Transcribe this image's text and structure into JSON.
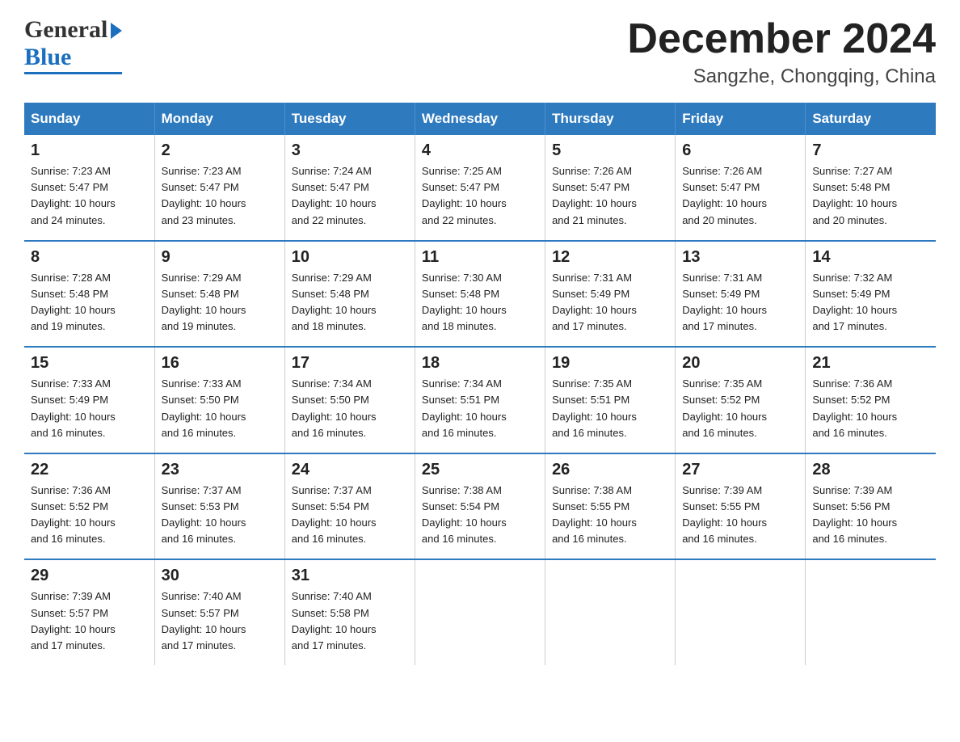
{
  "header": {
    "title": "December 2024",
    "subtitle": "Sangzhe, Chongqing, China",
    "logo_general": "General",
    "logo_blue": "Blue"
  },
  "columns": [
    "Sunday",
    "Monday",
    "Tuesday",
    "Wednesday",
    "Thursday",
    "Friday",
    "Saturday"
  ],
  "weeks": [
    [
      {
        "day": "1",
        "sunrise": "7:23 AM",
        "sunset": "5:47 PM",
        "daylight": "10 hours and 24 minutes."
      },
      {
        "day": "2",
        "sunrise": "7:23 AM",
        "sunset": "5:47 PM",
        "daylight": "10 hours and 23 minutes."
      },
      {
        "day": "3",
        "sunrise": "7:24 AM",
        "sunset": "5:47 PM",
        "daylight": "10 hours and 22 minutes."
      },
      {
        "day": "4",
        "sunrise": "7:25 AM",
        "sunset": "5:47 PM",
        "daylight": "10 hours and 22 minutes."
      },
      {
        "day": "5",
        "sunrise": "7:26 AM",
        "sunset": "5:47 PM",
        "daylight": "10 hours and 21 minutes."
      },
      {
        "day": "6",
        "sunrise": "7:26 AM",
        "sunset": "5:47 PM",
        "daylight": "10 hours and 20 minutes."
      },
      {
        "day": "7",
        "sunrise": "7:27 AM",
        "sunset": "5:48 PM",
        "daylight": "10 hours and 20 minutes."
      }
    ],
    [
      {
        "day": "8",
        "sunrise": "7:28 AM",
        "sunset": "5:48 PM",
        "daylight": "10 hours and 19 minutes."
      },
      {
        "day": "9",
        "sunrise": "7:29 AM",
        "sunset": "5:48 PM",
        "daylight": "10 hours and 19 minutes."
      },
      {
        "day": "10",
        "sunrise": "7:29 AM",
        "sunset": "5:48 PM",
        "daylight": "10 hours and 18 minutes."
      },
      {
        "day": "11",
        "sunrise": "7:30 AM",
        "sunset": "5:48 PM",
        "daylight": "10 hours and 18 minutes."
      },
      {
        "day": "12",
        "sunrise": "7:31 AM",
        "sunset": "5:49 PM",
        "daylight": "10 hours and 17 minutes."
      },
      {
        "day": "13",
        "sunrise": "7:31 AM",
        "sunset": "5:49 PM",
        "daylight": "10 hours and 17 minutes."
      },
      {
        "day": "14",
        "sunrise": "7:32 AM",
        "sunset": "5:49 PM",
        "daylight": "10 hours and 17 minutes."
      }
    ],
    [
      {
        "day": "15",
        "sunrise": "7:33 AM",
        "sunset": "5:49 PM",
        "daylight": "10 hours and 16 minutes."
      },
      {
        "day": "16",
        "sunrise": "7:33 AM",
        "sunset": "5:50 PM",
        "daylight": "10 hours and 16 minutes."
      },
      {
        "day": "17",
        "sunrise": "7:34 AM",
        "sunset": "5:50 PM",
        "daylight": "10 hours and 16 minutes."
      },
      {
        "day": "18",
        "sunrise": "7:34 AM",
        "sunset": "5:51 PM",
        "daylight": "10 hours and 16 minutes."
      },
      {
        "day": "19",
        "sunrise": "7:35 AM",
        "sunset": "5:51 PM",
        "daylight": "10 hours and 16 minutes."
      },
      {
        "day": "20",
        "sunrise": "7:35 AM",
        "sunset": "5:52 PM",
        "daylight": "10 hours and 16 minutes."
      },
      {
        "day": "21",
        "sunrise": "7:36 AM",
        "sunset": "5:52 PM",
        "daylight": "10 hours and 16 minutes."
      }
    ],
    [
      {
        "day": "22",
        "sunrise": "7:36 AM",
        "sunset": "5:52 PM",
        "daylight": "10 hours and 16 minutes."
      },
      {
        "day": "23",
        "sunrise": "7:37 AM",
        "sunset": "5:53 PM",
        "daylight": "10 hours and 16 minutes."
      },
      {
        "day": "24",
        "sunrise": "7:37 AM",
        "sunset": "5:54 PM",
        "daylight": "10 hours and 16 minutes."
      },
      {
        "day": "25",
        "sunrise": "7:38 AM",
        "sunset": "5:54 PM",
        "daylight": "10 hours and 16 minutes."
      },
      {
        "day": "26",
        "sunrise": "7:38 AM",
        "sunset": "5:55 PM",
        "daylight": "10 hours and 16 minutes."
      },
      {
        "day": "27",
        "sunrise": "7:39 AM",
        "sunset": "5:55 PM",
        "daylight": "10 hours and 16 minutes."
      },
      {
        "day": "28",
        "sunrise": "7:39 AM",
        "sunset": "5:56 PM",
        "daylight": "10 hours and 16 minutes."
      }
    ],
    [
      {
        "day": "29",
        "sunrise": "7:39 AM",
        "sunset": "5:57 PM",
        "daylight": "10 hours and 17 minutes."
      },
      {
        "day": "30",
        "sunrise": "7:40 AM",
        "sunset": "5:57 PM",
        "daylight": "10 hours and 17 minutes."
      },
      {
        "day": "31",
        "sunrise": "7:40 AM",
        "sunset": "5:58 PM",
        "daylight": "10 hours and 17 minutes."
      },
      {
        "day": "",
        "sunrise": "",
        "sunset": "",
        "daylight": ""
      },
      {
        "day": "",
        "sunrise": "",
        "sunset": "",
        "daylight": ""
      },
      {
        "day": "",
        "sunrise": "",
        "sunset": "",
        "daylight": ""
      },
      {
        "day": "",
        "sunrise": "",
        "sunset": "",
        "daylight": ""
      }
    ]
  ],
  "labels": {
    "sunrise_prefix": "Sunrise: ",
    "sunset_prefix": "Sunset: ",
    "daylight_prefix": "Daylight: "
  }
}
